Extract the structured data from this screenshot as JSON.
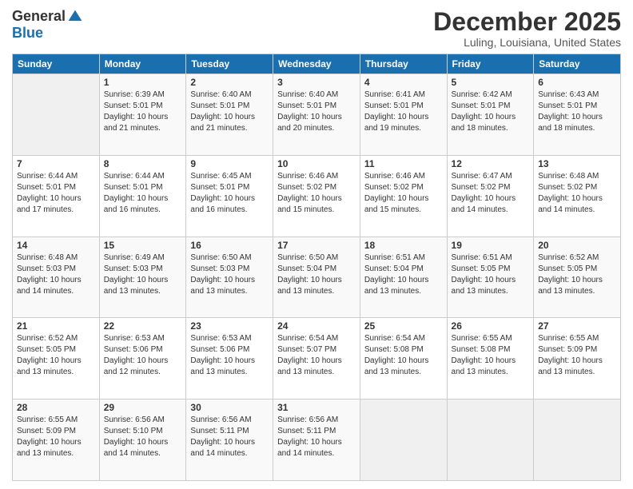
{
  "logo": {
    "general": "General",
    "blue": "Blue"
  },
  "title": "December 2025",
  "location": "Luling, Louisiana, United States",
  "days_of_week": [
    "Sunday",
    "Monday",
    "Tuesday",
    "Wednesday",
    "Thursday",
    "Friday",
    "Saturday"
  ],
  "weeks": [
    [
      {
        "day": "",
        "info": ""
      },
      {
        "day": "1",
        "info": "Sunrise: 6:39 AM\nSunset: 5:01 PM\nDaylight: 10 hours\nand 21 minutes."
      },
      {
        "day": "2",
        "info": "Sunrise: 6:40 AM\nSunset: 5:01 PM\nDaylight: 10 hours\nand 21 minutes."
      },
      {
        "day": "3",
        "info": "Sunrise: 6:40 AM\nSunset: 5:01 PM\nDaylight: 10 hours\nand 20 minutes."
      },
      {
        "day": "4",
        "info": "Sunrise: 6:41 AM\nSunset: 5:01 PM\nDaylight: 10 hours\nand 19 minutes."
      },
      {
        "day": "5",
        "info": "Sunrise: 6:42 AM\nSunset: 5:01 PM\nDaylight: 10 hours\nand 18 minutes."
      },
      {
        "day": "6",
        "info": "Sunrise: 6:43 AM\nSunset: 5:01 PM\nDaylight: 10 hours\nand 18 minutes."
      }
    ],
    [
      {
        "day": "7",
        "info": "Sunrise: 6:44 AM\nSunset: 5:01 PM\nDaylight: 10 hours\nand 17 minutes."
      },
      {
        "day": "8",
        "info": "Sunrise: 6:44 AM\nSunset: 5:01 PM\nDaylight: 10 hours\nand 16 minutes."
      },
      {
        "day": "9",
        "info": "Sunrise: 6:45 AM\nSunset: 5:01 PM\nDaylight: 10 hours\nand 16 minutes."
      },
      {
        "day": "10",
        "info": "Sunrise: 6:46 AM\nSunset: 5:02 PM\nDaylight: 10 hours\nand 15 minutes."
      },
      {
        "day": "11",
        "info": "Sunrise: 6:46 AM\nSunset: 5:02 PM\nDaylight: 10 hours\nand 15 minutes."
      },
      {
        "day": "12",
        "info": "Sunrise: 6:47 AM\nSunset: 5:02 PM\nDaylight: 10 hours\nand 14 minutes."
      },
      {
        "day": "13",
        "info": "Sunrise: 6:48 AM\nSunset: 5:02 PM\nDaylight: 10 hours\nand 14 minutes."
      }
    ],
    [
      {
        "day": "14",
        "info": "Sunrise: 6:48 AM\nSunset: 5:03 PM\nDaylight: 10 hours\nand 14 minutes."
      },
      {
        "day": "15",
        "info": "Sunrise: 6:49 AM\nSunset: 5:03 PM\nDaylight: 10 hours\nand 13 minutes."
      },
      {
        "day": "16",
        "info": "Sunrise: 6:50 AM\nSunset: 5:03 PM\nDaylight: 10 hours\nand 13 minutes."
      },
      {
        "day": "17",
        "info": "Sunrise: 6:50 AM\nSunset: 5:04 PM\nDaylight: 10 hours\nand 13 minutes."
      },
      {
        "day": "18",
        "info": "Sunrise: 6:51 AM\nSunset: 5:04 PM\nDaylight: 10 hours\nand 13 minutes."
      },
      {
        "day": "19",
        "info": "Sunrise: 6:51 AM\nSunset: 5:05 PM\nDaylight: 10 hours\nand 13 minutes."
      },
      {
        "day": "20",
        "info": "Sunrise: 6:52 AM\nSunset: 5:05 PM\nDaylight: 10 hours\nand 13 minutes."
      }
    ],
    [
      {
        "day": "21",
        "info": "Sunrise: 6:52 AM\nSunset: 5:05 PM\nDaylight: 10 hours\nand 13 minutes."
      },
      {
        "day": "22",
        "info": "Sunrise: 6:53 AM\nSunset: 5:06 PM\nDaylight: 10 hours\nand 12 minutes."
      },
      {
        "day": "23",
        "info": "Sunrise: 6:53 AM\nSunset: 5:06 PM\nDaylight: 10 hours\nand 13 minutes."
      },
      {
        "day": "24",
        "info": "Sunrise: 6:54 AM\nSunset: 5:07 PM\nDaylight: 10 hours\nand 13 minutes."
      },
      {
        "day": "25",
        "info": "Sunrise: 6:54 AM\nSunset: 5:08 PM\nDaylight: 10 hours\nand 13 minutes."
      },
      {
        "day": "26",
        "info": "Sunrise: 6:55 AM\nSunset: 5:08 PM\nDaylight: 10 hours\nand 13 minutes."
      },
      {
        "day": "27",
        "info": "Sunrise: 6:55 AM\nSunset: 5:09 PM\nDaylight: 10 hours\nand 13 minutes."
      }
    ],
    [
      {
        "day": "28",
        "info": "Sunrise: 6:55 AM\nSunset: 5:09 PM\nDaylight: 10 hours\nand 13 minutes."
      },
      {
        "day": "29",
        "info": "Sunrise: 6:56 AM\nSunset: 5:10 PM\nDaylight: 10 hours\nand 14 minutes."
      },
      {
        "day": "30",
        "info": "Sunrise: 6:56 AM\nSunset: 5:11 PM\nDaylight: 10 hours\nand 14 minutes."
      },
      {
        "day": "31",
        "info": "Sunrise: 6:56 AM\nSunset: 5:11 PM\nDaylight: 10 hours\nand 14 minutes."
      },
      {
        "day": "",
        "info": ""
      },
      {
        "day": "",
        "info": ""
      },
      {
        "day": "",
        "info": ""
      }
    ]
  ]
}
